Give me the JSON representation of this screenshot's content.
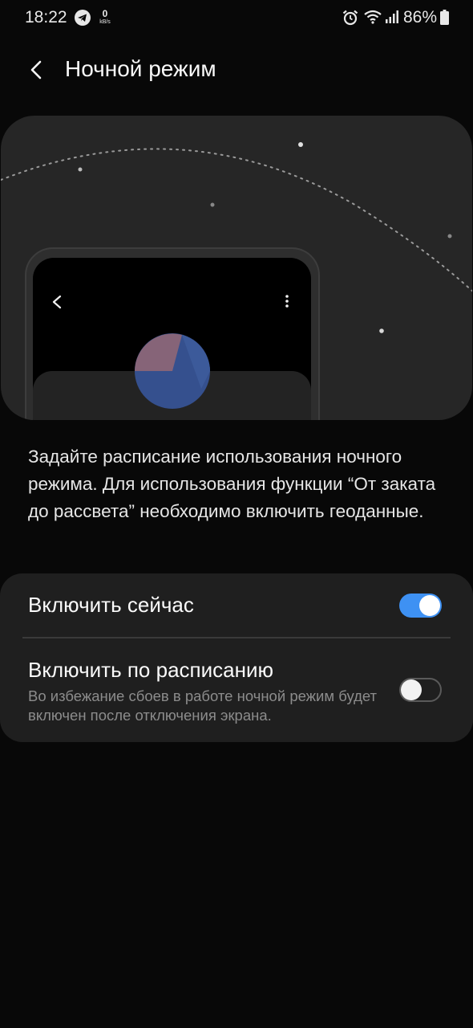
{
  "status_bar": {
    "time": "18:22",
    "net_speed_value": "0",
    "net_speed_unit": "kB/s",
    "battery_percent": "86%",
    "icons": [
      "telegram-icon",
      "alarm-icon",
      "wifi-icon",
      "signal-icon",
      "battery-icon"
    ]
  },
  "header": {
    "back_icon": "chevron-left-icon",
    "title": "Ночной режим"
  },
  "illustration": {
    "icons": [
      "moon-icon",
      "chevron-left-icon",
      "more-vertical-icon"
    ],
    "colors": {
      "moon": "#f5c518",
      "card": "#262626"
    }
  },
  "description": "Задайте расписание использования ночного режима. Для использования функции “От заката до рассвета” необходимо включить геоданные.",
  "settings": {
    "turn_on_now": {
      "label": "Включить сейчас",
      "enabled": true
    },
    "scheduled": {
      "label": "Включить по расписанию",
      "subtitle": "Во избежание сбоев в работе ночной режим будет включен после отключения экрана.",
      "enabled": false
    }
  },
  "colors": {
    "accent": "#3e91f3",
    "background": "#080808",
    "card": "#1f1f1f"
  }
}
